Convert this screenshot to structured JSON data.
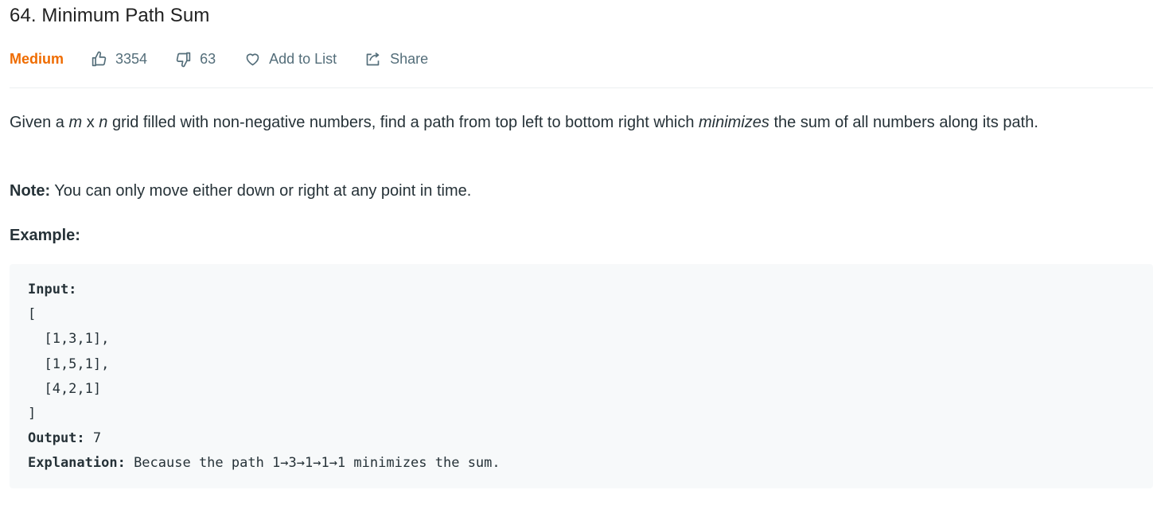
{
  "problem": {
    "title": "64. Minimum Path Sum",
    "difficulty": "Medium",
    "likes": "3354",
    "dislikes": "63",
    "add_to_list": "Add to List",
    "share": "Share"
  },
  "description": {
    "intro_1": "Given a ",
    "m": "m",
    "x": " x ",
    "n": "n",
    "intro_2": " grid filled with non-negative numbers, find a path from top left to bottom right which ",
    "minimizes": "minimizes",
    "intro_3": " the sum of all numbers along its path.",
    "note_label": "Note:",
    "note_text": " You can only move either down or right at any point in time.",
    "example_title": "Example:"
  },
  "example": {
    "input_label": "Input:",
    "open_bracket": "[",
    "row_1": "  [1,3,1],",
    "row_2": "  [1,5,1],",
    "row_3": "  [4,2,1]",
    "close_bracket": "]",
    "output_label": "Output:",
    "output_value": " 7",
    "explanation_label": "Explanation:",
    "explanation_text": " Because the path 1→3→1→1→1 minimizes the sum."
  },
  "colors": {
    "difficulty_medium": "#ef6c00",
    "meta_text": "#546e7a",
    "code_background": "#f7f9fa"
  },
  "icons": [
    "thumbs-up-icon",
    "thumbs-down-icon",
    "heart-icon",
    "share-icon"
  ]
}
